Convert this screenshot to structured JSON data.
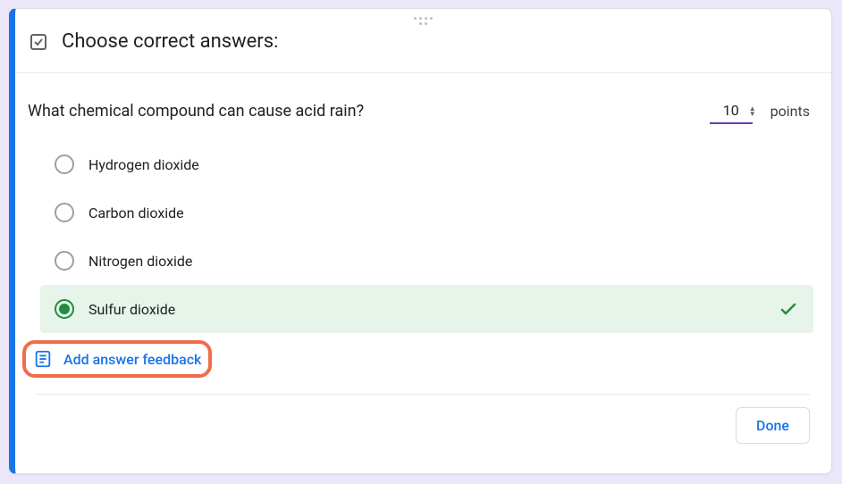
{
  "header": {
    "title": "Choose correct answers:"
  },
  "question": {
    "text": "What chemical compound can cause acid rain?",
    "points_value": "10",
    "points_label": "points"
  },
  "options": [
    {
      "label": "Hydrogen dioxide",
      "correct": false
    },
    {
      "label": "Carbon dioxide",
      "correct": false
    },
    {
      "label": "Nitrogen dioxide",
      "correct": false
    },
    {
      "label": "Sulfur dioxide",
      "correct": true
    }
  ],
  "feedback": {
    "label": "Add answer feedback"
  },
  "footer": {
    "done_label": "Done"
  }
}
